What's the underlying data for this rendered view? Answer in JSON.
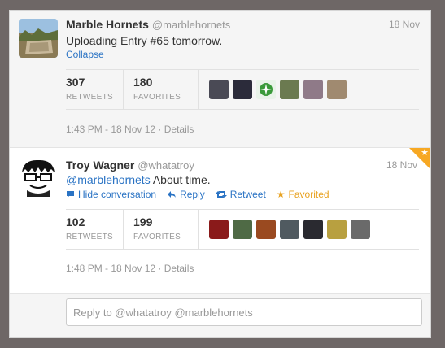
{
  "tweets": [
    {
      "name": "Marble Hornets",
      "handle": "@marblehornets",
      "date": "18 Nov",
      "text": "Uploading Entry #65 tomorrow.",
      "collapse": "Collapse",
      "retweets": "307",
      "retweets_label": "RETWEETS",
      "favorites": "180",
      "favorites_label": "FAVORITES",
      "timestamp": "1:43 PM - 18 Nov 12",
      "details": "Details",
      "faces": [
        "#4a4a55",
        "#2b2b3a",
        "#3a9a3a",
        "#6b7a50",
        "#8f7a88",
        "#a08a70"
      ]
    },
    {
      "name": "Troy Wagner",
      "handle": "@whatatroy",
      "date": "18 Nov",
      "mention": "@marblehornets",
      "text": " About time.",
      "actions": {
        "hide": "Hide conversation",
        "reply": "Reply",
        "retweet": "Retweet",
        "favorited": "Favorited"
      },
      "retweets": "102",
      "retweets_label": "RETWEETS",
      "favorites": "199",
      "favorites_label": "FAVORITES",
      "timestamp": "1:48 PM - 18 Nov 12",
      "details": "Details",
      "faces": [
        "#8a1a1a",
        "#4f6a45",
        "#9a4a20",
        "#505a60",
        "#2a2a30",
        "#b8a040",
        "#6a6a6a"
      ]
    }
  ],
  "reply": {
    "placeholder": "Reply to @whatatroy @marblehornets"
  }
}
